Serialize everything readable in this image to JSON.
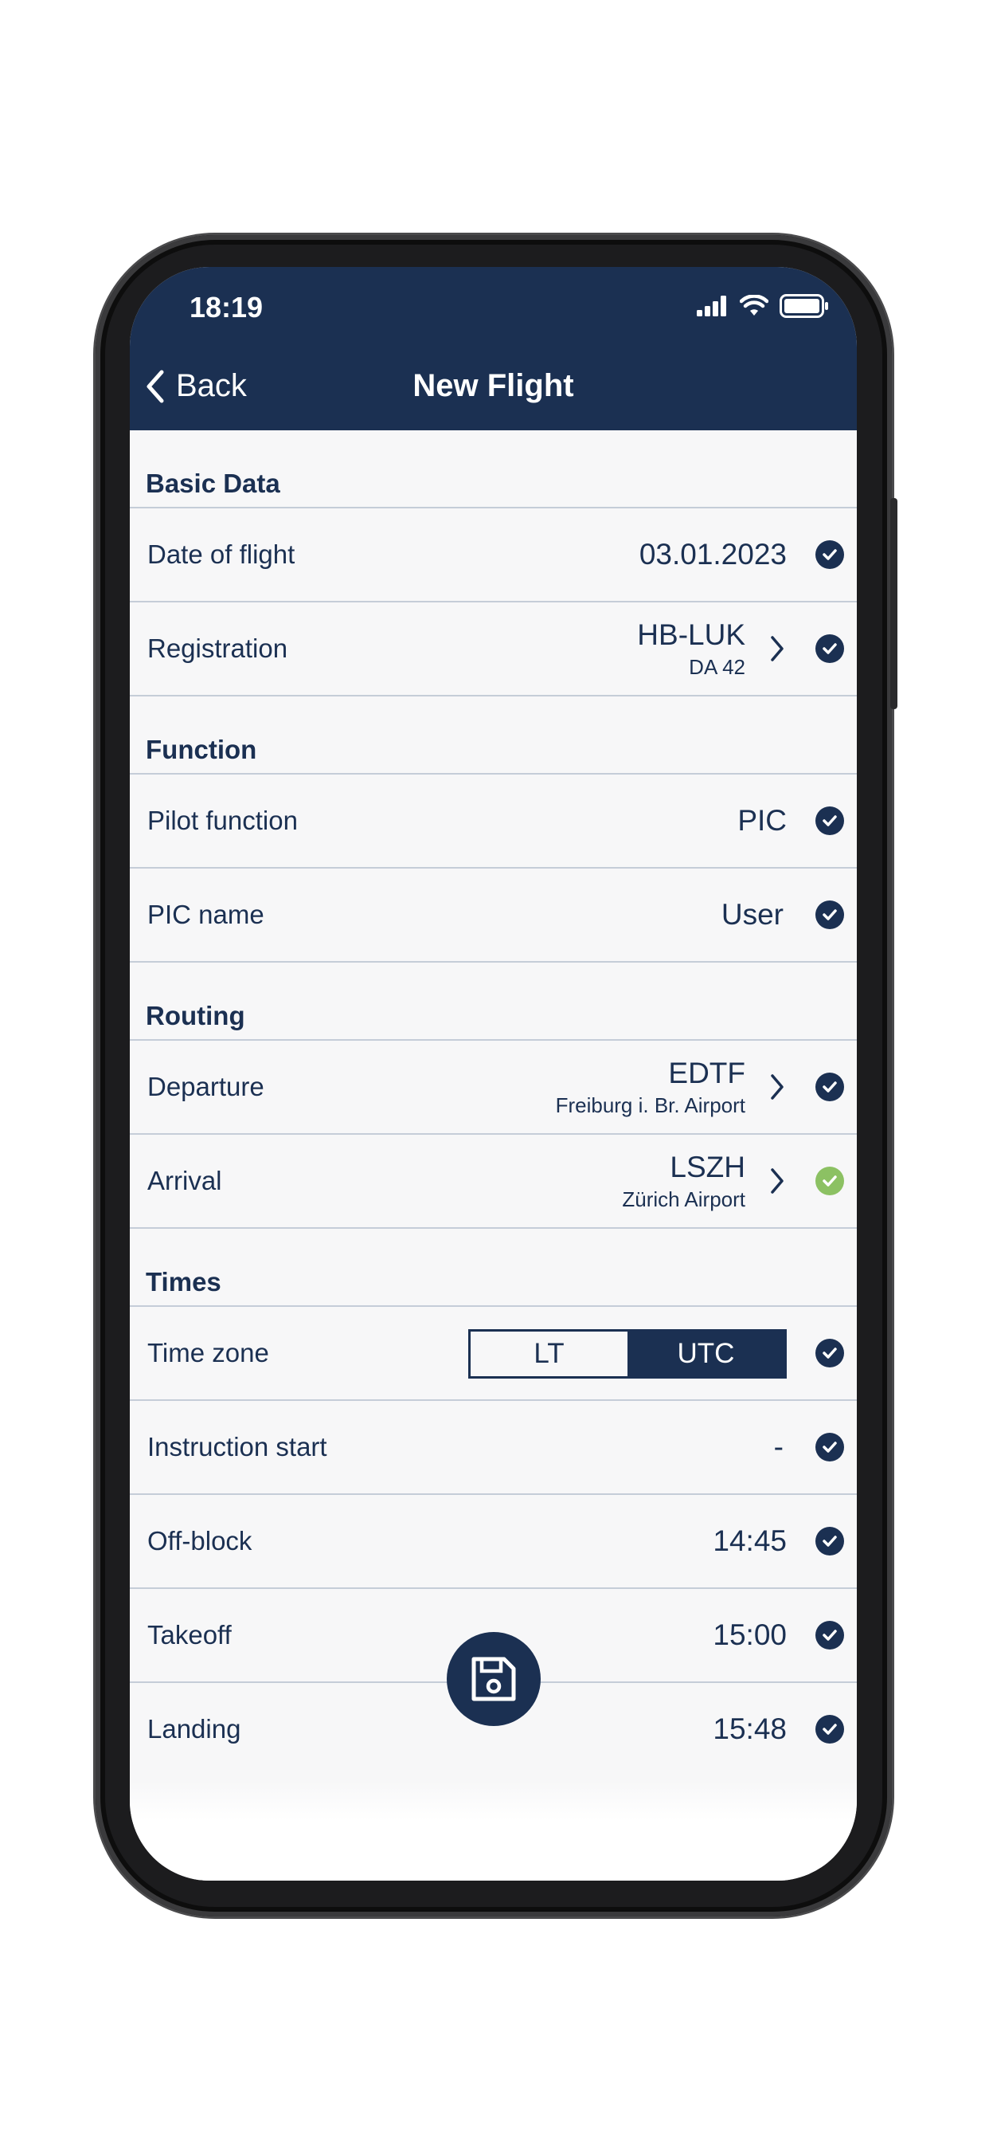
{
  "status_bar": {
    "time": "18:19"
  },
  "nav": {
    "back_label": "Back",
    "title": "New Flight"
  },
  "sections": {
    "basic": {
      "header": "Basic Data",
      "date": {
        "label": "Date of flight",
        "value": "03.01.2023"
      },
      "registration": {
        "label": "Registration",
        "value": "HB-LUK",
        "sub": "DA 42"
      }
    },
    "function": {
      "header": "Function",
      "pilot_function": {
        "label": "Pilot function",
        "value": "PIC"
      },
      "pic_name": {
        "label": "PIC name",
        "value": "User"
      }
    },
    "routing": {
      "header": "Routing",
      "departure": {
        "label": "Departure",
        "value": "EDTF",
        "sub": "Freiburg i. Br. Airport"
      },
      "arrival": {
        "label": "Arrival",
        "value": "LSZH",
        "sub": "Zürich Airport"
      }
    },
    "times": {
      "header": "Times",
      "time_zone": {
        "label": "Time zone",
        "options": [
          "LT",
          "UTC"
        ],
        "selected": "UTC"
      },
      "instruction_start": {
        "label": "Instruction start",
        "value": "-"
      },
      "off_block": {
        "label": "Off-block",
        "value": "14:45"
      },
      "takeoff": {
        "label": "Takeoff",
        "value": "15:00"
      },
      "landing": {
        "label": "Landing",
        "value": "15:48"
      }
    }
  },
  "icons": {
    "check": "check-circle-icon",
    "check_complete": "check-circle-green-icon",
    "chevron": "chevron-right-icon",
    "save": "floppy-disk-icon"
  },
  "colors": {
    "primary": "#1b3052",
    "success": "#8cc163",
    "background": "#f7f7f8",
    "divider": "#c5cdd8"
  }
}
